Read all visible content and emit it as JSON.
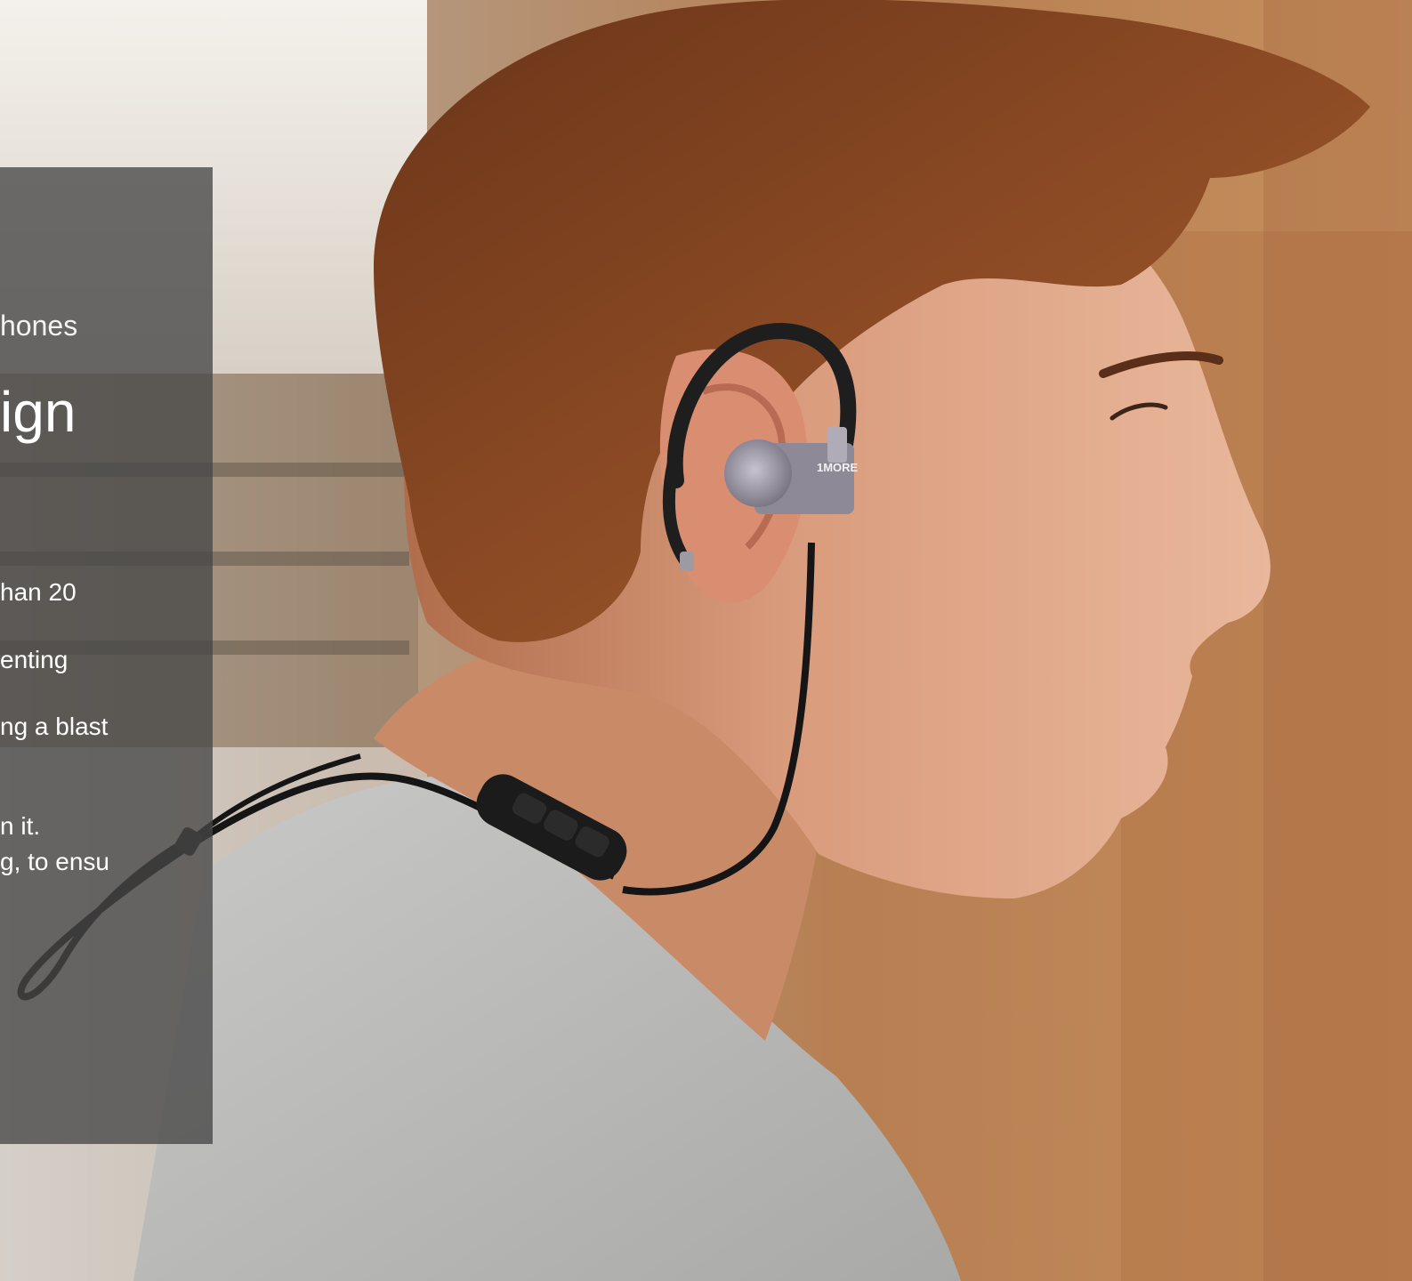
{
  "panel": {
    "eyebrow": "hones",
    "headline": "ign",
    "body_lines": [
      "han 20",
      "enting",
      "ng a blast",
      "n it.",
      "g, to ensu"
    ]
  },
  "photo": {
    "earphone_brand": "1MORE",
    "description_icon": "sport-earphones-photo"
  }
}
